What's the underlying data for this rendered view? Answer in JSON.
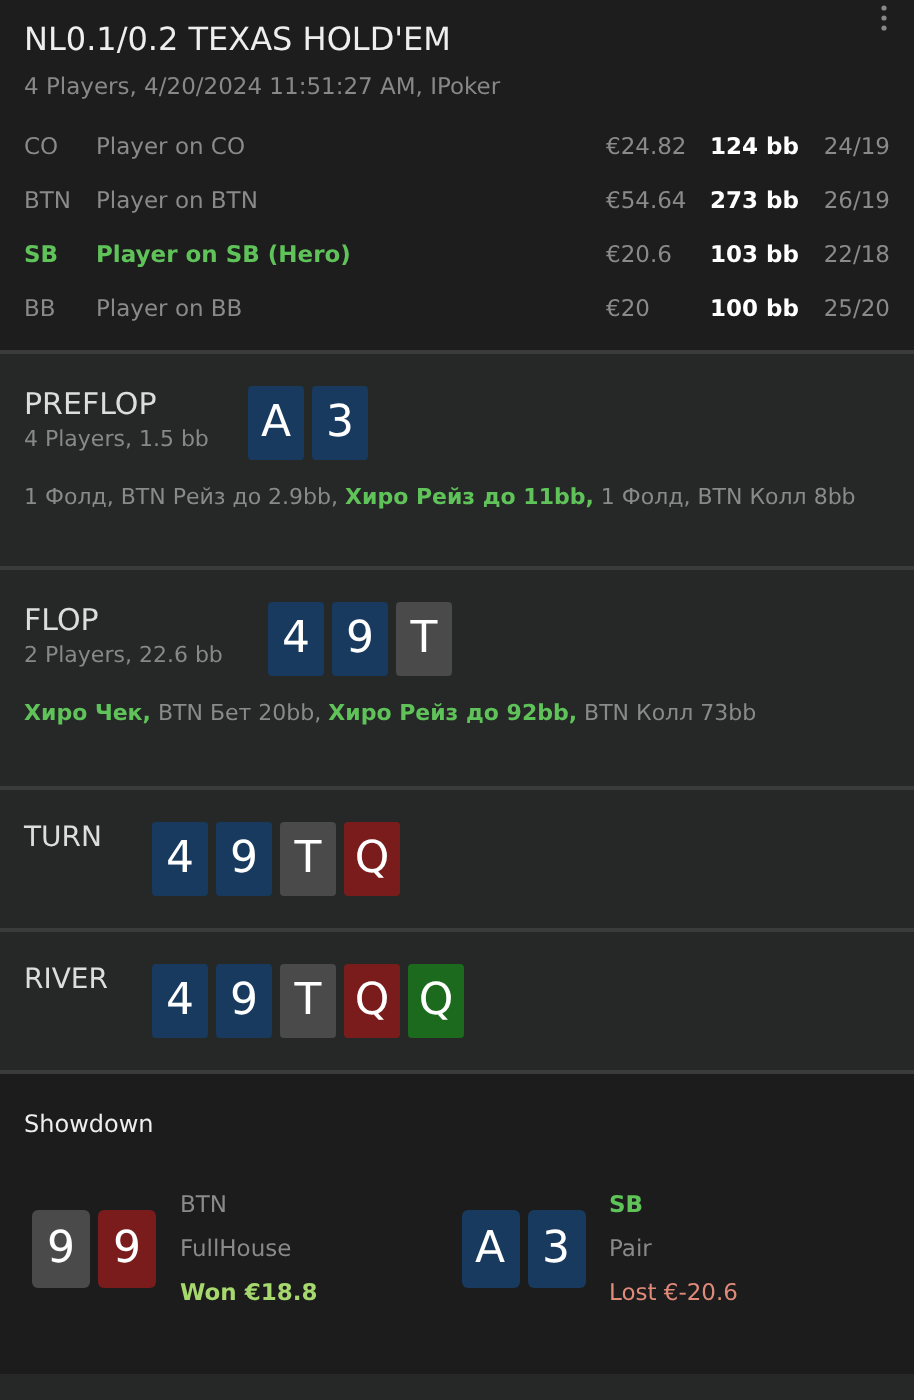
{
  "header": {
    "title": "NL0.1/0.2 TEXAS HOLD'EM",
    "subtitle": "4 Players, 4/20/2024 11:51:27 AM, IPoker"
  },
  "players": [
    {
      "position": "CO",
      "name": "Player on CO",
      "stack": "€24.82",
      "bb": "124 bb",
      "stats": "24/19",
      "hero": false
    },
    {
      "position": "BTN",
      "name": "Player on BTN",
      "stack": "€54.64",
      "bb": "273 bb",
      "stats": "26/19",
      "hero": false
    },
    {
      "position": "SB",
      "name": "Player on SB (Hero)",
      "stack": "€20.6",
      "bb": "103 bb",
      "stats": "22/18",
      "hero": true
    },
    {
      "position": "BB",
      "name": "Player on BB",
      "stack": "€20",
      "bb": "100 bb",
      "stats": "25/20",
      "hero": false
    }
  ],
  "streets": [
    {
      "name": "PREFLOP",
      "info": "4 Players, 1.5 bb",
      "cards": [
        {
          "rank": "A",
          "color": "#173a5e"
        },
        {
          "rank": "3",
          "color": "#173a5e"
        }
      ],
      "actions": [
        {
          "text": "1 Фолд, BTN Рейз до 2.9bb, ",
          "hero": false
        },
        {
          "text": "Хиро Рейз до 11bb,",
          "hero": true
        },
        {
          "text": " 1 Фолд, BTN Колл 8bb",
          "hero": false
        }
      ]
    },
    {
      "name": "FLOP",
      "info": "2 Players, 22.6 bb",
      "cards": [
        {
          "rank": "4",
          "color": "#173a5e"
        },
        {
          "rank": "9",
          "color": "#173a5e"
        },
        {
          "rank": "T",
          "color": "#4a4a4a"
        }
      ],
      "actions": [
        {
          "text": "Хиро Чек,",
          "hero": true
        },
        {
          "text": " BTN Бет 20bb, ",
          "hero": false
        },
        {
          "text": "Хиро Рейз до 92bb,",
          "hero": true
        },
        {
          "text": " BTN Колл 73bb",
          "hero": false
        }
      ]
    },
    {
      "name": "TURN",
      "cards": [
        {
          "rank": "4",
          "color": "#173a5e"
        },
        {
          "rank": "9",
          "color": "#173a5e"
        },
        {
          "rank": "T",
          "color": "#4a4a4a"
        },
        {
          "rank": "Q",
          "color": "#7a1c1c"
        }
      ]
    },
    {
      "name": "RIVER",
      "cards": [
        {
          "rank": "4",
          "color": "#173a5e"
        },
        {
          "rank": "9",
          "color": "#173a5e"
        },
        {
          "rank": "T",
          "color": "#4a4a4a"
        },
        {
          "rank": "Q",
          "color": "#7a1c1c"
        },
        {
          "rank": "Q",
          "color": "#1b6a1e"
        }
      ]
    }
  ],
  "showdown": {
    "title": "Showdown",
    "hands": [
      {
        "cards": [
          {
            "rank": "9",
            "color": "#4a4a4a"
          },
          {
            "rank": "9",
            "color": "#7a1c1c"
          }
        ],
        "position": "BTN",
        "hero": false,
        "hand": "FullHouse",
        "result": "Won €18.8",
        "kind": "won"
      },
      {
        "cards": [
          {
            "rank": "A",
            "color": "#173a5e"
          },
          {
            "rank": "3",
            "color": "#173a5e"
          }
        ],
        "position": "SB",
        "hero": true,
        "hand": "Pair",
        "result": "Lost €-20.6",
        "kind": "lost"
      }
    ]
  }
}
